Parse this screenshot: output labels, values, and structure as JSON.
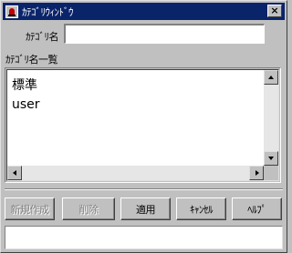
{
  "window": {
    "title": "ｶﾃｺﾞﾘｳｨﾝﾄﾞｳ",
    "close_label": "×"
  },
  "form": {
    "name_label": "ｶﾃｺﾞﾘ名",
    "name_value": ""
  },
  "list": {
    "heading": "ｶﾃｺﾞﾘ名一覧",
    "items": [
      "標準",
      "user"
    ]
  },
  "buttons": {
    "new": "新規作成",
    "delete": "削除",
    "apply": "適用",
    "cancel": "ｷｬﾝｾﾙ",
    "help": "ﾍﾙﾌﾟ"
  },
  "status": {
    "text": ""
  }
}
